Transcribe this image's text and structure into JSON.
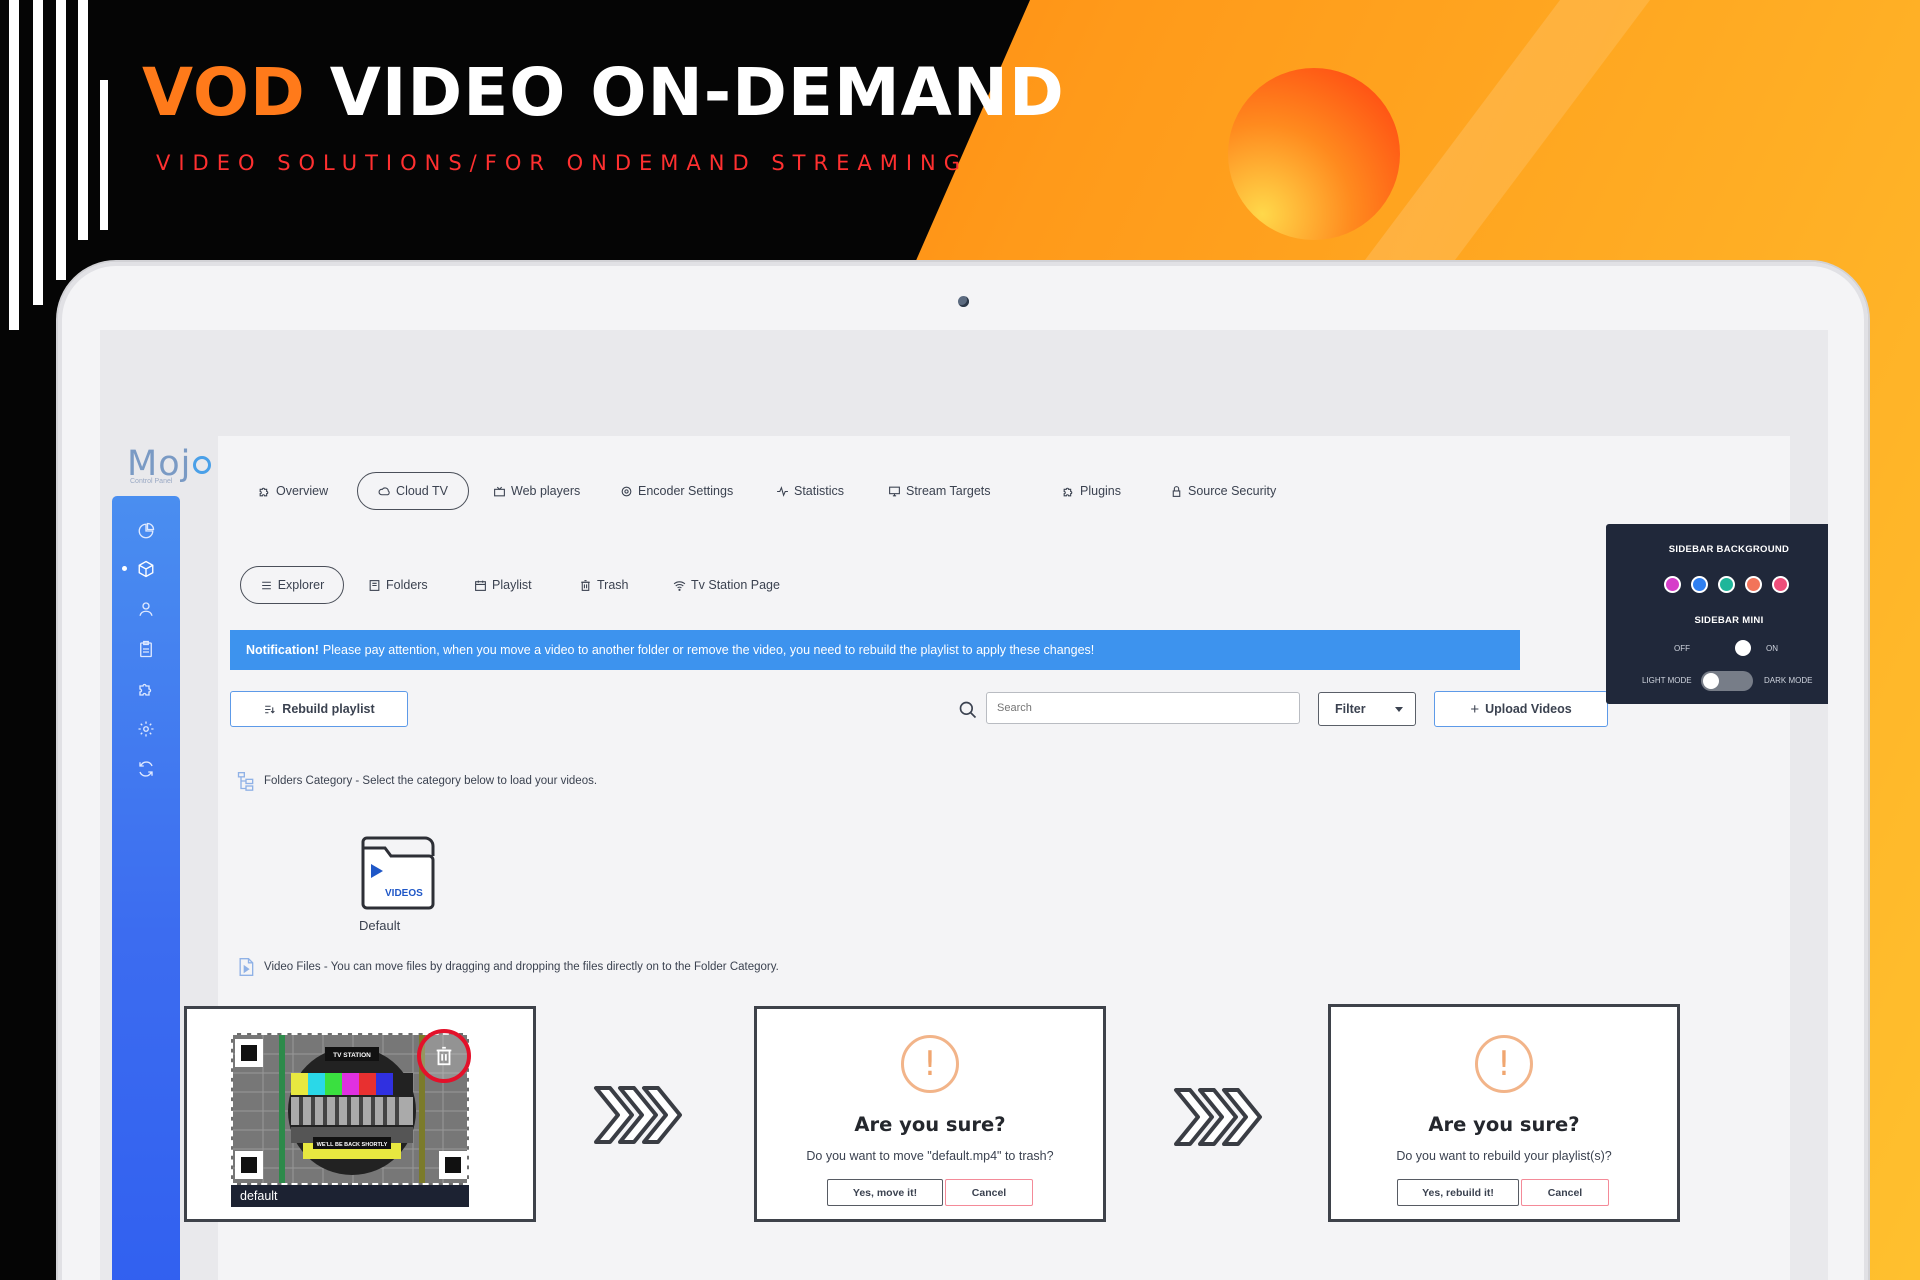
{
  "banner": {
    "title_accent": "VOD",
    "title_rest": "VIDEO ON-DEMAND",
    "subtitle": "VIDEO SOLUTIONS/FOR ONDEMAND STREAMING"
  },
  "app": {
    "logo": "Moj",
    "logo_sub": "Control Panel"
  },
  "nav": [
    {
      "label": "Overview",
      "icon": "puzzle-icon"
    },
    {
      "label": "Cloud TV",
      "icon": "cloud-icon",
      "active": true
    },
    {
      "label": "Web players",
      "icon": "player-icon"
    },
    {
      "label": "Encoder Settings",
      "icon": "settings-icon"
    },
    {
      "label": "Statistics",
      "icon": "activity-icon"
    },
    {
      "label": "Stream Targets",
      "icon": "monitor-icon"
    },
    {
      "label": "Plugins",
      "icon": "puzzle-icon"
    },
    {
      "label": "Source Security",
      "icon": "lock-icon"
    }
  ],
  "subtabs": [
    {
      "label": "Explorer",
      "icon": "list-icon",
      "active": true
    },
    {
      "label": "Folders",
      "icon": "folder-icon"
    },
    {
      "label": "Playlist",
      "icon": "calendar-icon"
    },
    {
      "label": "Trash",
      "icon": "trash-icon"
    },
    {
      "label": "Tv Station Page",
      "icon": "wifi-icon"
    }
  ],
  "notification": {
    "bold": "Notification!",
    "text": "Please pay attention, when you move a video to another folder or remove the video, you need to rebuild the playlist to apply these changes!"
  },
  "actions": {
    "rebuild": "Rebuild playlist",
    "search_placeholder": "Search",
    "filter": "Filter",
    "upload": "Upload Videos"
  },
  "folders_caption": "Folders Category - Select the category below to load your videos.",
  "folder": {
    "badge": "VIDEOS",
    "label": "Default"
  },
  "video_caption": "Video Files - You can move files by dragging and dropping the files directly on to the Folder Category.",
  "video": {
    "name": "default",
    "station_label": "TV STATION",
    "bottom_label": "WE'LL BE BACK SHORTLY"
  },
  "dialog_trash": {
    "icon": "!",
    "title": "Are you sure?",
    "text": "Do you want to move \"default.mp4\" to trash?",
    "confirm": "Yes, move it!",
    "cancel": "Cancel"
  },
  "dialog_rebuild": {
    "icon": "!",
    "title": "Are you sure?",
    "text": "Do you want to rebuild your playlist(s)?",
    "confirm": "Yes, rebuild it!",
    "cancel": "Cancel"
  },
  "settings": {
    "bg_title": "SIDEBAR BACKGROUND",
    "swatches": [
      "#d63ec9",
      "#2f7ff0",
      "#1fb69a",
      "#f2745a",
      "#ee4e7a"
    ],
    "mini_title": "SIDEBAR MINI",
    "off": "OFF",
    "on": "ON",
    "light": "LIGHT MODE",
    "dark": "DARK MODE"
  },
  "colors": {
    "accent_orange": "#ff7a1a",
    "sidebar_blue": "#3c6cf0",
    "notification_blue": "#3d93ee"
  }
}
